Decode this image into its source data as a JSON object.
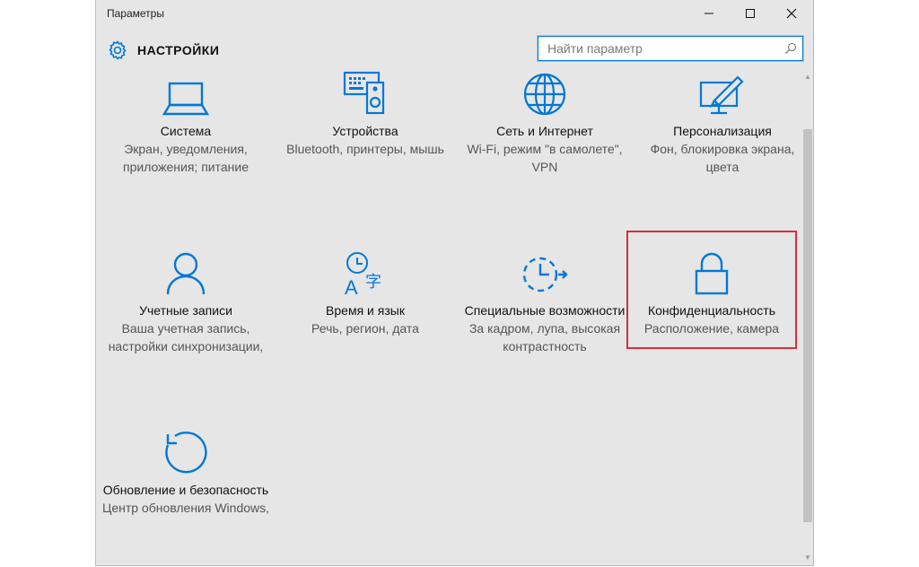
{
  "window": {
    "title": "Параметры",
    "accent": "#0078d7",
    "highlight_color": "#d32f3c"
  },
  "header": {
    "title": "НАСТРОЙКИ",
    "icon": "gear-icon"
  },
  "search": {
    "placeholder": "Найти параметр",
    "icon": "search-icon"
  },
  "tiles": [
    {
      "name": "Система",
      "desc": "Экран, уведомления, приложения; питание",
      "icon": "laptop-icon"
    },
    {
      "name": "Устройства",
      "desc": "Bluetooth, принтеры, мышь",
      "icon": "devices-icon"
    },
    {
      "name": "Сеть и Интернет",
      "desc": "Wi-Fi, режим \"в самолете\", VPN",
      "icon": "globe-icon"
    },
    {
      "name": "Персонализация",
      "desc": "Фон, блокировка экрана, цвета",
      "icon": "personalization-icon"
    },
    {
      "name": "Учетные записи",
      "desc": "Ваша учетная запись, настройки синхронизации,",
      "icon": "person-icon"
    },
    {
      "name": "Время и язык",
      "desc": "Речь, регион, дата",
      "icon": "time-language-icon"
    },
    {
      "name": "Специальные возможности",
      "desc": "За кадром, лупа, высокая контрастность",
      "icon": "accessibility-icon"
    },
    {
      "name": "Конфиденциальность",
      "desc": "Расположение, камера",
      "icon": "lock-icon"
    },
    {
      "name": "Обновление и безопасность",
      "desc": "Центр обновления Windows,",
      "icon": "update-icon"
    }
  ]
}
